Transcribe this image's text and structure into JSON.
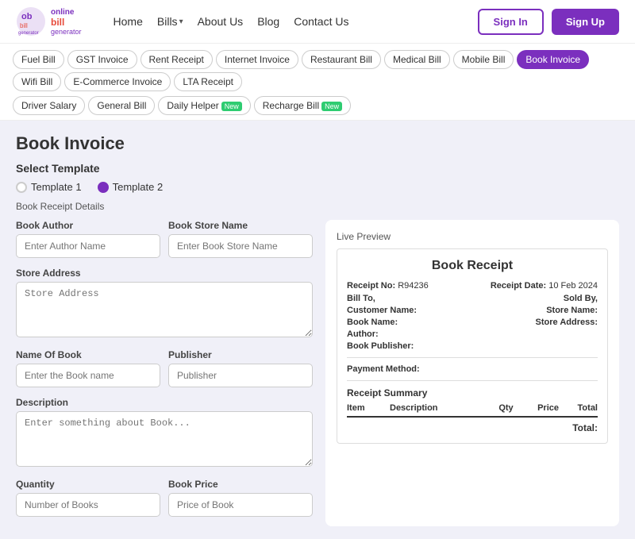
{
  "header": {
    "logo_line1": "online",
    "logo_line2": "bill",
    "logo_line3": "generator",
    "nav": {
      "home": "Home",
      "bills": "Bills",
      "about_us": "About Us",
      "blog": "Blog",
      "contact_us": "Contact Us"
    },
    "signin": "Sign In",
    "signup": "Sign Up"
  },
  "categories": [
    {
      "label": "Fuel Bill",
      "active": false,
      "new": false
    },
    {
      "label": "GST Invoice",
      "active": false,
      "new": false
    },
    {
      "label": "Rent Receipt",
      "active": false,
      "new": false
    },
    {
      "label": "Internet Invoice",
      "active": false,
      "new": false
    },
    {
      "label": "Restaurant Bill",
      "active": false,
      "new": false
    },
    {
      "label": "Medical Bill",
      "active": false,
      "new": false
    },
    {
      "label": "Mobile Bill",
      "active": false,
      "new": false
    },
    {
      "label": "Book Invoice",
      "active": true,
      "new": false
    },
    {
      "label": "Wifi Bill",
      "active": false,
      "new": false
    },
    {
      "label": "E-Commerce Invoice",
      "active": false,
      "new": false
    },
    {
      "label": "LTA Receipt",
      "active": false,
      "new": false
    }
  ],
  "categories_row2": [
    {
      "label": "Driver Salary",
      "active": false,
      "new": false
    },
    {
      "label": "General Bill",
      "active": false,
      "new": false
    },
    {
      "label": "Daily Helper",
      "active": false,
      "new": true
    },
    {
      "label": "Recharge Bill",
      "active": false,
      "new": true
    }
  ],
  "page": {
    "title": "Book Invoice",
    "select_template_label": "Select Template",
    "template1_label": "Template 1",
    "template2_label": "Template 2",
    "receipt_details_label": "Book Receipt Details",
    "live_preview_label": "Live Preview"
  },
  "form": {
    "book_author_label": "Book Author",
    "book_author_placeholder": "Enter Author Name",
    "book_store_label": "Book Store Name",
    "book_store_placeholder": "Enter Book Store Name",
    "store_address_label": "Store Address",
    "store_address_placeholder": "Store Address",
    "name_of_book_label": "Name Of Book",
    "name_of_book_placeholder": "Enter the Book name",
    "publisher_label": "Publisher",
    "publisher_placeholder": "Publisher",
    "description_label": "Description",
    "description_placeholder": "Enter something about Book...",
    "quantity_label": "Quantity",
    "quantity_placeholder": "Number of Books",
    "book_price_label": "Book Price",
    "book_price_placeholder": "Price of Book"
  },
  "preview": {
    "receipt_title": "Book Receipt",
    "receipt_no_label": "Receipt No:",
    "receipt_no_value": "R94236",
    "receipt_date_label": "Receipt Date:",
    "receipt_date_value": "10 Feb 2024",
    "bill_to_label": "Bill To,",
    "sold_by_label": "Sold By,",
    "customer_name_label": "Customer Name:",
    "store_name_label": "Store Name:",
    "book_name_label": "Book Name:",
    "store_address_label": "Store Address:",
    "author_label": "Author:",
    "book_publisher_label": "Book Publisher:",
    "payment_method_label": "Payment Method:",
    "receipt_summary_label": "Receipt Summary",
    "table_item": "Item",
    "table_description": "Description",
    "table_qty": "Qty",
    "table_price": "Price",
    "table_total": "Total",
    "total_label": "Total:"
  },
  "colors": {
    "accent": "#7b2fbe",
    "active_tab": "#7b2fbe",
    "new_badge": "#2ecc71"
  }
}
